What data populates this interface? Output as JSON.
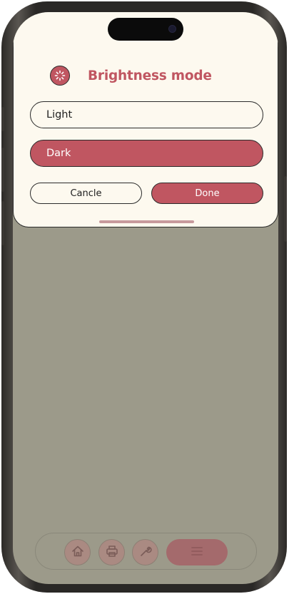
{
  "sheet": {
    "title": "Brightness mode",
    "options": [
      {
        "label": "Light",
        "selected": false
      },
      {
        "label": "Dark",
        "selected": true
      }
    ],
    "cancel_label": "Cancle",
    "done_label": "Done"
  },
  "icons": {
    "header": "brightness-icon",
    "nav": [
      "home-icon",
      "printer-icon",
      "wrench-icon",
      "menu-icon"
    ]
  },
  "colors": {
    "accent": "#c05661",
    "sheet_background": "#fdf9ef",
    "overlay": "#9c9a8a"
  }
}
